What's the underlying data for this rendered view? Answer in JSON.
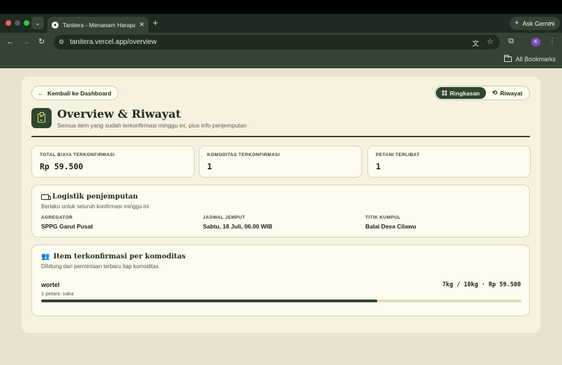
{
  "browser": {
    "tab_title": "Tanitera - Menanam Harapan",
    "tab_favicon": "▲",
    "new_tab": "+",
    "ask_gemini": "Ask Gemini",
    "url": "tanitera.vercel.app/overview",
    "profile_initial": "K",
    "bookmarks_all": "All Bookmarks"
  },
  "header": {
    "back_label": "Kembali ke Dashboard",
    "tabs": [
      {
        "label": "Ringkasan",
        "active": true,
        "icon": "grid-icon"
      },
      {
        "label": "Riwayat",
        "active": false,
        "icon": "history-icon"
      }
    ],
    "title": "Overview & Riwayat",
    "subtitle": "Semua item yang sudah terkonfirmasi minggu ini, plus info penjemputan"
  },
  "stats": [
    {
      "label": "TOTAL BIAYA TERKONFIRMASI",
      "value": "Rp 59.500"
    },
    {
      "label": "KOMODITAS TERKONFIRMASI",
      "value": "1"
    },
    {
      "label": "PETANI TERLIBAT",
      "value": "1"
    }
  ],
  "logistics": {
    "title": "Logistik penjemputan",
    "subtitle": "Berlaku untuk seluruh konfirmasi minggu ini",
    "fields": [
      {
        "label": "AGREGATOR",
        "value": "SPPG Garut Pusat"
      },
      {
        "label": "JADWAL JEMPUT",
        "value": "Sabtu, 18 Juli, 06.00 WIB"
      },
      {
        "label": "TITIK KUMPUL",
        "value": "Balai Desa Cilawu"
      }
    ]
  },
  "items": {
    "title": "Item terkonfirmasi per komoditas",
    "subtitle": "Dihitung dari permintaan terbaru tiap komoditas",
    "list": [
      {
        "name": "wortel",
        "qty": "7kg / 10kg · Rp 59.500",
        "farmers": "1 petani: saka",
        "progress": 0.7
      }
    ]
  },
  "colors": {
    "accent": "#2f4731",
    "background": "#e7e3ce",
    "card": "#f6f2df",
    "icon_yellow": "#f0d779"
  }
}
